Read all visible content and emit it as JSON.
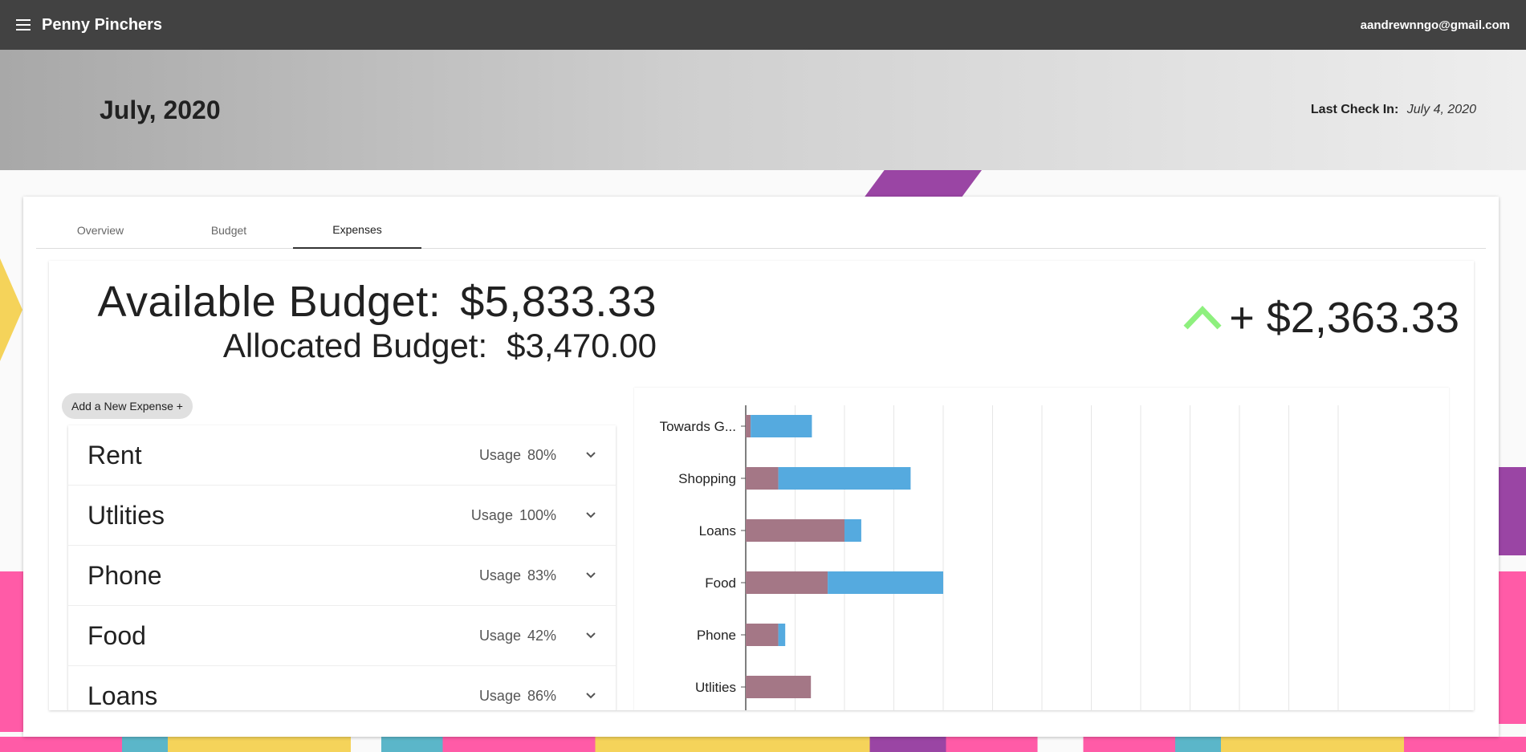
{
  "app": {
    "title": "Penny Pinchers",
    "user_email": "aandrewnngo@gmail.com"
  },
  "banner": {
    "month": "July, 2020",
    "checkin_label": "Last Check In:",
    "checkin_date": "July 4, 2020"
  },
  "tabs": [
    {
      "label": "Overview",
      "active": false
    },
    {
      "label": "Budget",
      "active": false
    },
    {
      "label": "Expenses",
      "active": true
    }
  ],
  "summary": {
    "available_label": "Available Budget:",
    "available_value": "$5,833.33",
    "allocated_label": "Allocated Budget:",
    "allocated_value": "$3,470.00",
    "difference": "+ $2,363.33",
    "difference_icon": "chevron-up-icon",
    "difference_color": "#8ef07e"
  },
  "add_button": {
    "label": "Add a New Expense +"
  },
  "expenses": [
    {
      "name": "Rent",
      "usage_label": "Usage",
      "usage": "80%"
    },
    {
      "name": "Utlities",
      "usage_label": "Usage",
      "usage": "100%"
    },
    {
      "name": "Phone",
      "usage_label": "Usage",
      "usage": "83%"
    },
    {
      "name": "Food",
      "usage_label": "Usage",
      "usage": "42%"
    },
    {
      "name": "Loans",
      "usage_label": "Usage",
      "usage": "86%"
    }
  ],
  "chart_data": {
    "type": "bar",
    "orientation": "horizontal",
    "stacked": true,
    "categories": [
      "Towards G...",
      "Shopping",
      "Loans",
      "Food",
      "Phone",
      "Utlities"
    ],
    "series": [
      {
        "values": [
          5,
          33,
          100,
          83,
          33,
          66
        ],
        "color": "#a47786"
      },
      {
        "values": [
          62,
          134,
          17,
          117,
          7,
          0
        ],
        "color": "#55aadf"
      }
    ],
    "xlim": [
      0,
      600
    ],
    "grid": true
  }
}
